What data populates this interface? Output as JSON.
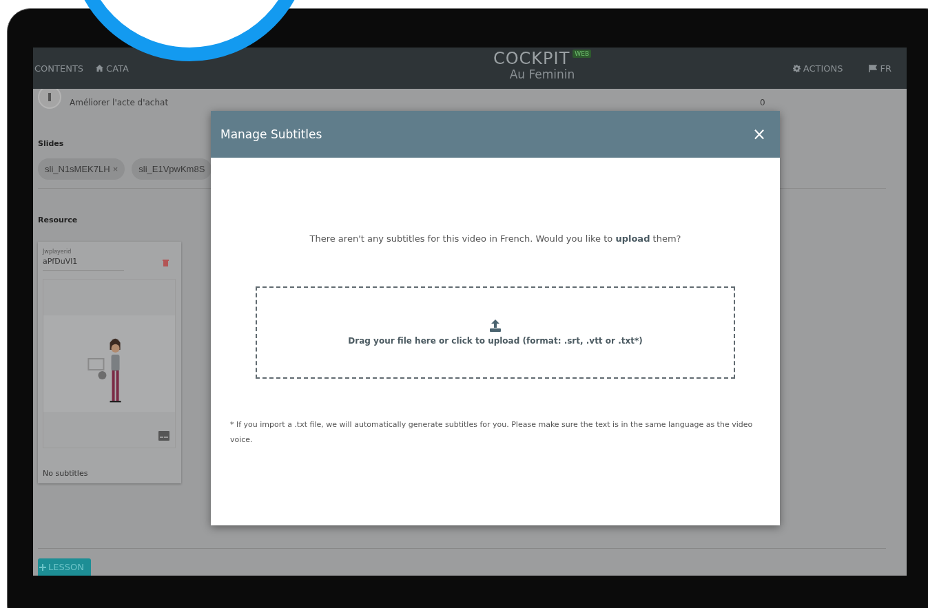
{
  "nav": {
    "left": [
      {
        "label": "CONTENTS",
        "kind": "text"
      },
      {
        "label": "CATA",
        "kind": "home"
      }
    ],
    "logo": "COCKPIT",
    "logo_badge": "WEB",
    "subtitle": "Au Feminin",
    "right": [
      {
        "label": "ACTIONS",
        "kind": "gear"
      },
      {
        "label": "FR",
        "kind": "flag"
      }
    ]
  },
  "objective": {
    "label": "Améliorer l'acte d'achat",
    "count": "0"
  },
  "slides": {
    "title": "Slides",
    "chips": [
      {
        "label": "sli_N1sMEK7LH",
        "removable": true,
        "remove": "×"
      },
      {
        "label": "sli_E1VpwKm8S",
        "removable": false
      }
    ]
  },
  "resource": {
    "title": "Resource",
    "field_label": "Jwplayerid",
    "field_value": "aPfDuVl1",
    "status": "No subtitles"
  },
  "add_button": {
    "label": "LESSON"
  },
  "modal": {
    "title": "Manage Subtitles",
    "close": "×",
    "message": "There aren't any subtitles for this video in French. Would you like to **upload** them?",
    "dropzone": "Drag your file here or click to upload (format: .srt, .vtt or .txt*)",
    "note": "* If you import a .txt file, we will automatically generate subtitles for you. Please make sure the text is in the same language as the video voice."
  }
}
